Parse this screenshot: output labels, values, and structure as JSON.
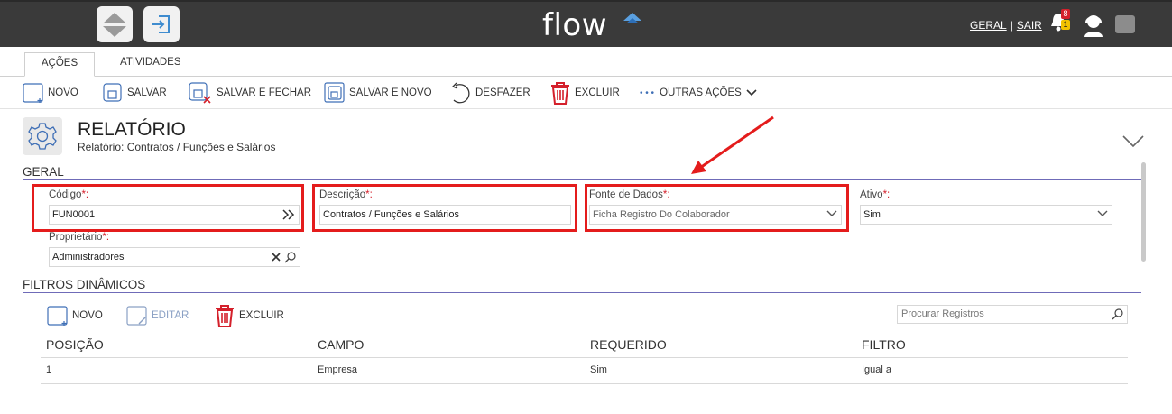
{
  "topbar": {
    "logo": "flow",
    "links": {
      "geral": "GERAL",
      "sair": "SAIR",
      "separator": "|"
    },
    "notifications": {
      "red_count": "8",
      "yellow_count": "1"
    },
    "icons": [
      "home-up-icon",
      "login-icon",
      "bell-icon",
      "support-icon",
      "chat-icon"
    ]
  },
  "tabs": [
    {
      "label": "AÇÕES"
    },
    {
      "label": "ATIVIDADES"
    }
  ],
  "toolbar": {
    "novo": "NOVO",
    "salvar": "SALVAR",
    "salvar_fechar": "SALVAR E FECHAR",
    "salvar_novo": "SALVAR E NOVO",
    "desfazer": "DESFAZER",
    "excluir": "EXCLUIR",
    "outras": "OUTRAS AÇÕES",
    "dots": "• • •"
  },
  "header": {
    "title": "RELATÓRIO",
    "subtitle": "Relatório: Contratos / Funções e Salários"
  },
  "sections": {
    "geral": "GERAL",
    "filtros": "FILTROS DINÂMICOS"
  },
  "form": {
    "codigo": {
      "label": "Código",
      "value": "FUN0001"
    },
    "descricao": {
      "label": "Descrição",
      "value": "Contratos / Funções e Salários"
    },
    "fonte": {
      "label": "Fonte de Dados",
      "value": "Ficha Registro Do Colaborador"
    },
    "ativo": {
      "label": "Ativo",
      "value": "Sim"
    },
    "proprietario": {
      "label": "Proprietário",
      "value": "Administradores"
    },
    "required_mark": "*:"
  },
  "filters_toolbar": {
    "novo": "NOVO",
    "editar": "EDITAR",
    "excluir": "EXCLUIR",
    "search_placeholder": "Procurar Registros"
  },
  "grid": {
    "columns": [
      "POSIÇÃO",
      "CAMPO",
      "REQUERIDO",
      "FILTRO"
    ],
    "rows": [
      [
        "1",
        "Empresa",
        "Sim",
        "Igual a"
      ]
    ]
  },
  "colors": {
    "topbar": "#3a3a3a",
    "accent_line": "#6f6bb8",
    "highlight": "#e41c1c",
    "icon_blue": "#3f6fb6",
    "delete_red": "#d4202b"
  }
}
